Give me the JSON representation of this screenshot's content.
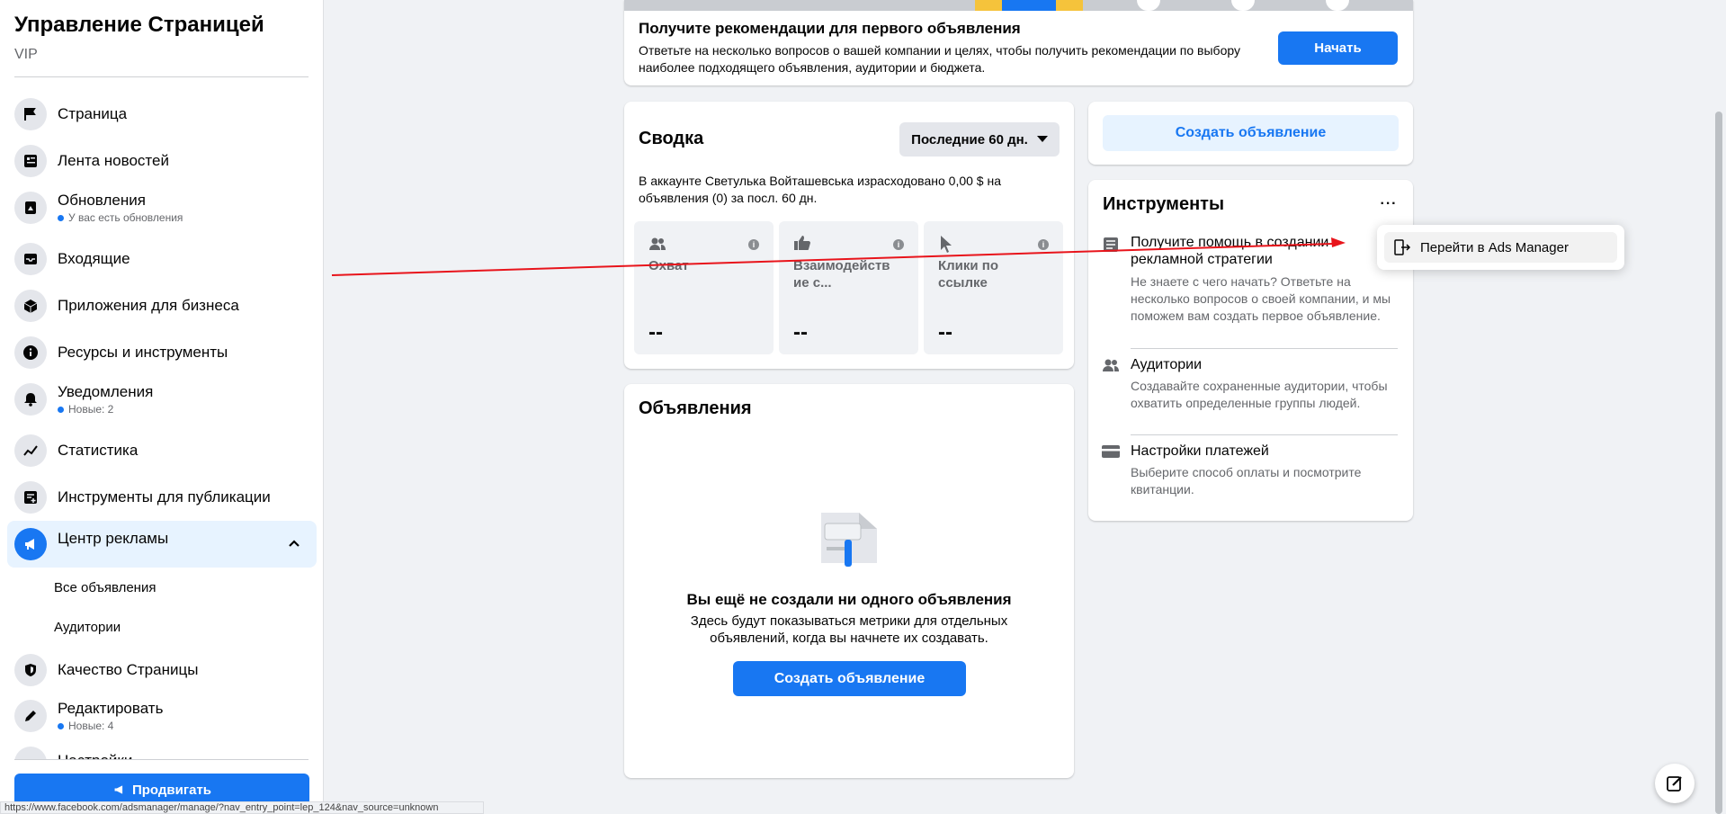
{
  "sidebar": {
    "title": "Управление Страницей",
    "subtitle": "VIP",
    "items": [
      {
        "label": "Страница",
        "icon": "flag-icon"
      },
      {
        "label": "Лента новостей",
        "icon": "news-feed-icon"
      },
      {
        "label": "Обновления",
        "icon": "updates-icon",
        "badge": "У вас есть обновления"
      },
      {
        "label": "Входящие",
        "icon": "inbox-icon"
      },
      {
        "label": "Приложения для бизнеса",
        "icon": "box-icon"
      },
      {
        "label": "Ресурсы и инструменты",
        "icon": "info-icon"
      },
      {
        "label": "Уведомления",
        "icon": "bell-icon",
        "badge": "Новые: 2"
      },
      {
        "label": "Статистика",
        "icon": "stats-icon"
      },
      {
        "label": "Инструменты для публикации",
        "icon": "publishing-tools-icon"
      },
      {
        "label": "Центр рекламы",
        "icon": "megaphone-icon"
      },
      {
        "label": "Качество Страницы",
        "icon": "shield-icon"
      },
      {
        "label": "Редактировать",
        "icon": "pencil-icon",
        "badge": "Новые: 4"
      },
      {
        "label": "Настройки",
        "icon": "gear-icon"
      }
    ],
    "subitems": [
      "Все объявления",
      "Аудитории"
    ],
    "promote_label": "Продвигать"
  },
  "status_url": "https://www.facebook.com/adsmanager/manage/?nav_entry_point=lep_124&nav_source=unknown",
  "banner": {
    "title": "Получите рекомендации для первого объявления",
    "desc": "Ответьте на несколько вопросов о вашей компании и целях, чтобы получить рекомендации по выбору наиболее подходящего объявления, аудитории и бюджета.",
    "button": "Начать"
  },
  "summary": {
    "title": "Сводка",
    "period": "Последние 60 дн.",
    "text": "В аккаунте Светулька Войташевська израсходовано 0,00 $ на объявления (0) за посл. 60 дн.",
    "metrics": [
      {
        "label": "Охват",
        "value": "--",
        "icon": "people-icon"
      },
      {
        "label": "Взаимодейств ие с...",
        "value": "--",
        "icon": "thumbs-up-icon"
      },
      {
        "label": "Клики по ссылке",
        "value": "--",
        "icon": "cursor-icon"
      }
    ]
  },
  "ads": {
    "title": "Объявления",
    "empty_title": "Вы ещё не создали ни одного объявления",
    "empty_desc": "Здесь будут показываться метрики для отдельных объявлений, когда вы начнете их создавать.",
    "button": "Создать объявление"
  },
  "create_card": {
    "button": "Создать объявление"
  },
  "tools": {
    "title": "Инструменты",
    "items": [
      {
        "title": "Получите помощь в создании рекламной стратегии",
        "desc": "Не знаете с чего начать? Ответьте на несколько вопросов о своей компании, и мы поможем вам создать первое объявление.",
        "icon": "document-icon"
      },
      {
        "title": "Аудитории",
        "desc": "Создавайте сохраненные аудитории, чтобы охватить определенные группы людей.",
        "icon": "people-icon"
      },
      {
        "title": "Настройки платежей",
        "desc": "Выберите способ оплаты и посмотрите квитанции.",
        "icon": "credit-card-icon"
      }
    ]
  },
  "dropdown": {
    "item": "Перейти в Ads Manager",
    "icon": "exit-icon"
  },
  "colors": {
    "accent": "#1877f2",
    "annotation": "#e8141b"
  }
}
